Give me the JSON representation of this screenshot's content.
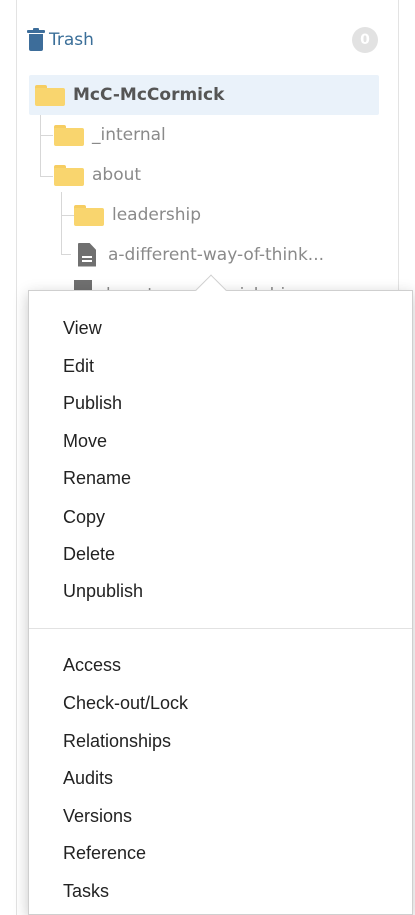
{
  "tree": {
    "trash": {
      "label": "Trash",
      "count": "0"
    },
    "root": {
      "label": "McC-McCormick"
    },
    "nodes": [
      {
        "label": "_internal",
        "type": "folder"
      },
      {
        "label": "about",
        "type": "folder"
      },
      {
        "label": "leadership",
        "type": "folder"
      },
      {
        "label": "a-different-way-of-think...",
        "type": "page"
      }
    ],
    "hidden_node_fragment": "how-to-mccormick-bi..."
  },
  "context_menu": {
    "group1": [
      "View",
      "Edit",
      "Publish",
      "Move",
      "Rename",
      "Copy",
      "Delete",
      "Unpublish"
    ],
    "group2": [
      "Access",
      "Check-out/Lock",
      "Relationships",
      "Audits",
      "Versions",
      "Reference",
      "Tasks"
    ]
  },
  "colors": {
    "trash_blue": "#3d6d9a",
    "folder_yellow": "#f9d56e",
    "selected_row_bg": "#eaf2fa"
  }
}
